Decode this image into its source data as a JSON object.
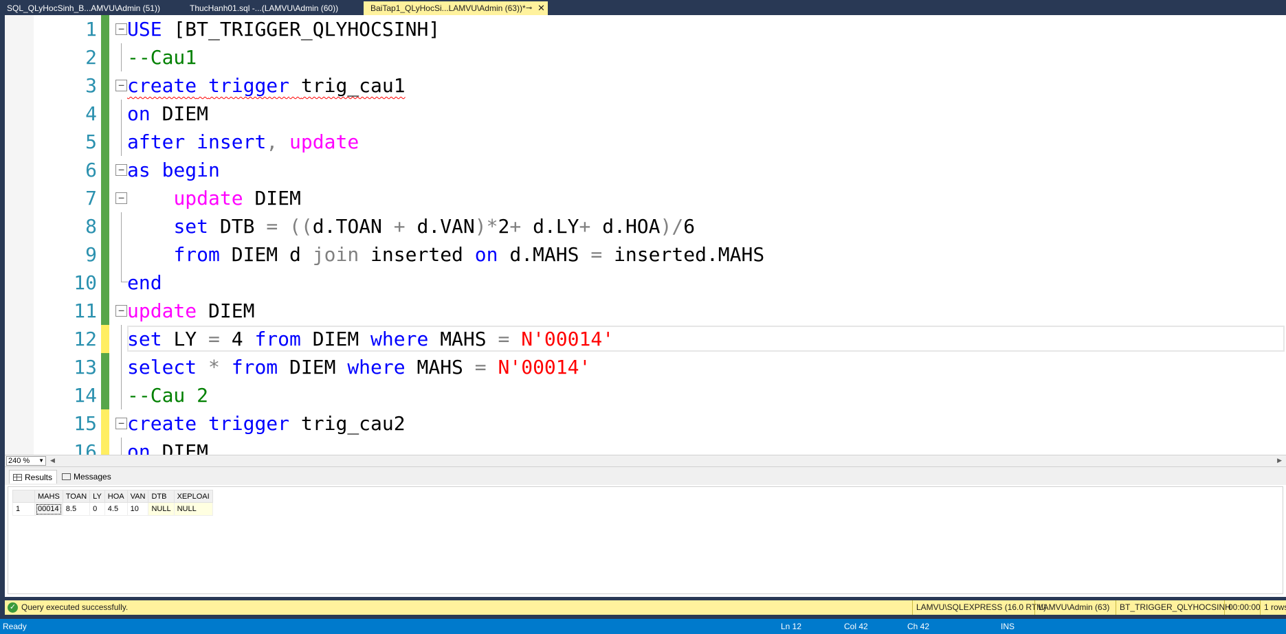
{
  "tabs": [
    {
      "label": "SQL_QLyHocSinh_B...AMVU\\Admin (51))",
      "active": false
    },
    {
      "label": "ThucHanh01.sql -...(LAMVU\\Admin (60))",
      "active": false
    },
    {
      "label": "BaiTap1_QLyHocSi...LAMVU\\Admin (63))*",
      "active": true
    }
  ],
  "tab_pin_glyph": "⊸",
  "tab_close_glyph": "✕",
  "editor": {
    "lines": [
      {
        "n": "1",
        "change": "green"
      },
      {
        "n": "2",
        "change": "green"
      },
      {
        "n": "3",
        "change": "green"
      },
      {
        "n": "4",
        "change": "green"
      },
      {
        "n": "5",
        "change": "green"
      },
      {
        "n": "6",
        "change": "green"
      },
      {
        "n": "7",
        "change": "green"
      },
      {
        "n": "8",
        "change": "green"
      },
      {
        "n": "9",
        "change": "green"
      },
      {
        "n": "10",
        "change": "green"
      },
      {
        "n": "11",
        "change": "green"
      },
      {
        "n": "12",
        "change": "yellow"
      },
      {
        "n": "13",
        "change": "green"
      },
      {
        "n": "14",
        "change": "green"
      },
      {
        "n": "15",
        "change": "yellow"
      },
      {
        "n": "16",
        "change": "yellow"
      }
    ],
    "t": {
      "use": "USE",
      "db": "[BT_TRIGGER_QLYHOCSINH]",
      "cm1": "--Cau1",
      "create": "create",
      "trigger": "trigger",
      "trig1": "trig_cau1",
      "on": "on",
      "diem": "DIEM",
      "after": "after",
      "insert": "insert",
      "comma": ",",
      "update": "update",
      "as": "as",
      "begin": "begin",
      "set": "set",
      "dtb": "DTB",
      "eq": "=",
      "lp2": "((",
      "dt": "d.TOAN",
      "plus": "+",
      "dv": "d.VAN",
      "rpstar": ")*",
      "two": "2",
      "dl": "d.LY",
      "dh": "d.HOA",
      "rpslash": ")/",
      "six": "6",
      "from": "from",
      "dalias": "d",
      "join": "join",
      "inserted": "inserted",
      "dmahs": "d.MAHS",
      "insmahs": "inserted.MAHS",
      "end": "end",
      "ly": "LY",
      "four": "4",
      "where": "where",
      "mahs": "MAHS",
      "str": "N'00014'",
      "select": "select",
      "star": "*",
      "cm2": "--Cau 2",
      "trig2": "trig_cau2"
    }
  },
  "zoom": "240 %",
  "results": {
    "tabs": [
      {
        "label": "Results",
        "icon": "grid-icon",
        "active": true
      },
      {
        "label": "Messages",
        "icon": "messages-icon",
        "active": false
      }
    ],
    "columns": [
      "MAHS",
      "TOAN",
      "LY",
      "HOA",
      "VAN",
      "DTB",
      "XEPLOAI"
    ],
    "rows": [
      {
        "rownum": "1",
        "cells": [
          "00014",
          "8.5",
          "0",
          "4.5",
          "10",
          "NULL",
          "NULL"
        ]
      }
    ]
  },
  "query_status": {
    "icon": "check-icon",
    "message": "Query executed successfully.",
    "server": "LAMVU\\SQLEXPRESS (16.0 RTM)",
    "user": "LAMVU\\Admin (63)",
    "database": "BT_TRIGGER_QLYHOCSINH",
    "elapsed": "00:00:00",
    "rows": "1 rows"
  },
  "app_status": {
    "state": "Ready",
    "ln": "Ln 12",
    "col": "Col 42",
    "ch": "Ch 42",
    "mode": "INS"
  }
}
